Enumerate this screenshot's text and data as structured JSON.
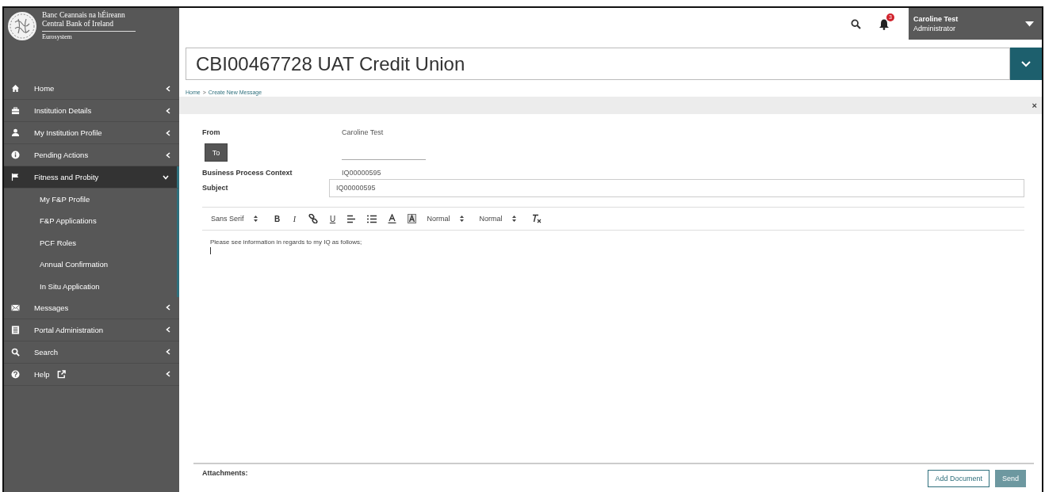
{
  "logo": {
    "irish_name": "Banc Ceannais na hÉireann",
    "english_name": "Central Bank of Ireland",
    "tagline": "Eurosystem"
  },
  "sidebar": {
    "items": [
      {
        "label": "Home",
        "expanded": false,
        "selected": false
      },
      {
        "label": "Institution Details",
        "expanded": false,
        "selected": false
      },
      {
        "label": "My Institution Profile",
        "expanded": false,
        "selected": false
      },
      {
        "label": "Pending Actions",
        "expanded": false,
        "selected": false
      },
      {
        "label": "Fitness and Probity",
        "expanded": true,
        "selected": true,
        "children": [
          {
            "label": "My F&P Profile"
          },
          {
            "label": "F&P Applications"
          },
          {
            "label": "PCF Roles"
          },
          {
            "label": "Annual Confirmation"
          },
          {
            "label": "In Situ Application"
          }
        ]
      },
      {
        "label": "Messages",
        "expanded": false,
        "selected": false
      },
      {
        "label": "Portal Administration",
        "expanded": false,
        "selected": false
      },
      {
        "label": "Search",
        "expanded": false,
        "selected": false
      },
      {
        "label": "Help",
        "expanded": false,
        "selected": false
      }
    ]
  },
  "header": {
    "notification_count": "3",
    "user_name": "Caroline Test",
    "user_role": "Administrator"
  },
  "institution": {
    "title": "CBI00467728 UAT Credit Union"
  },
  "breadcrumb": [
    {
      "label": "Home"
    },
    {
      "label": "Create New Message"
    }
  ],
  "breadcrumb_separator": ">",
  "panel": {
    "close": "×"
  },
  "form": {
    "from_label": "From",
    "from_value": "Caroline Test",
    "to_button": "To",
    "context_label": "Business Process Context",
    "context_value": "IQ00000595",
    "subject_label": "Subject",
    "subject_value": "IQ00000595"
  },
  "toolbar": [
    {
      "kind": "picker",
      "label": "Sans Serif"
    },
    {
      "kind": "bold",
      "label": "B"
    },
    {
      "kind": "italic",
      "label": "I"
    },
    {
      "kind": "link"
    },
    {
      "kind": "underline",
      "label": "U"
    },
    {
      "kind": "align"
    },
    {
      "kind": "list"
    },
    {
      "kind": "color"
    },
    {
      "kind": "background"
    },
    {
      "kind": "picker",
      "label": "Normal"
    },
    {
      "kind": "picker",
      "label": "Normal"
    },
    {
      "kind": "clear"
    }
  ],
  "editor": {
    "text": "Please see information in regards to my IQ as follows;"
  },
  "footer": {
    "attachments_label": "Attachments:",
    "add_button": "Add Document",
    "send_button": "Send"
  }
}
